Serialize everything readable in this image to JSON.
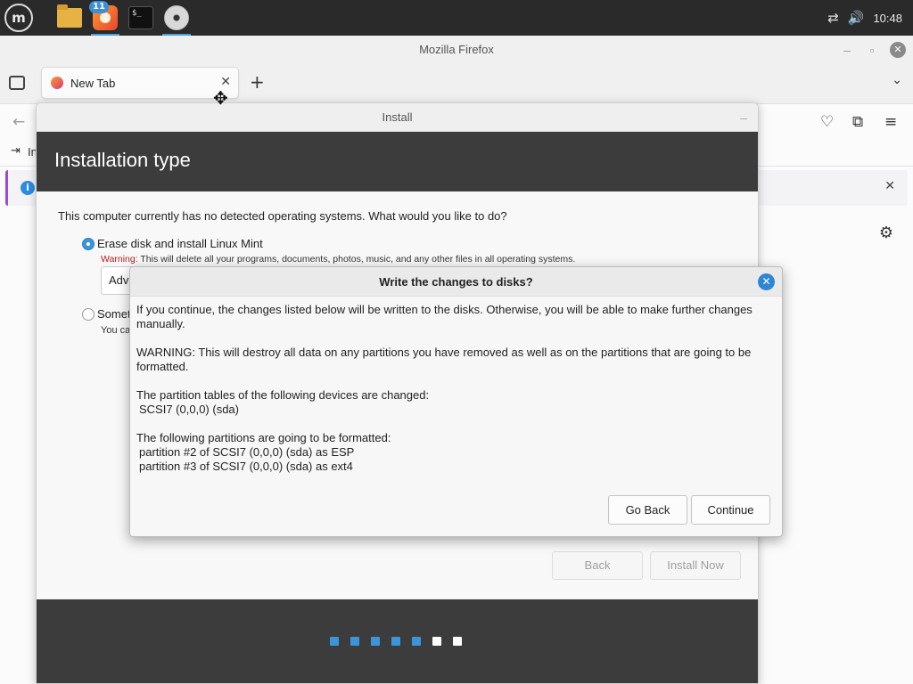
{
  "taskbar": {
    "menu_logo": "m",
    "firefox_badge": "11",
    "terminal_prompt": "$_",
    "clock": "10:48",
    "icons": [
      "mint-menu-icon",
      "files-icon",
      "firefox-icon",
      "terminal-icon",
      "disc-icon",
      "network-icon",
      "volume-icon"
    ]
  },
  "firefox": {
    "window_title": "Mozilla Firefox",
    "tab_label": "New Tab",
    "tab_close": "✕",
    "new_tab": "+",
    "bookmark_partial": "In",
    "info_icon": "i",
    "info_close": "✕"
  },
  "installer": {
    "window_title": "Install",
    "heading": "Installation type",
    "question": "This computer currently has no detected operating systems. What would you like to do?",
    "option_erase": "Erase disk and install Linux Mint",
    "warning_label": "Warning:",
    "warning_text": " This will delete all your programs, documents, photos, music, and any other files in all operating systems.",
    "advanced_button": "Adv",
    "option_something": "Someth",
    "option_something_note": "You ca",
    "back_button": "Back",
    "install_button": "Install Now",
    "progress": {
      "total": 7,
      "completed": 5,
      "active_color": "#3b95d8",
      "pending_color": "#ffffff"
    }
  },
  "dialog": {
    "title": "Write the changes to disks?",
    "close": "✕",
    "para1": "If you continue, the changes listed below will be written to the disks. Otherwise, you will be able to make further changes manually.",
    "para2": "WARNING: This will destroy all data on any partitions you have removed as well as on the partitions that are going to be formatted.",
    "para3_heading": "The partition tables of the following devices are changed:",
    "para3_items": [
      "SCSI7 (0,0,0) (sda)"
    ],
    "para4_heading": "The following partitions are going to be formatted:",
    "para4_items": [
      "partition #2 of SCSI7 (0,0,0) (sda) as ESP",
      "partition #3 of SCSI7 (0,0,0) (sda) as ext4"
    ],
    "go_back_button": "Go Back",
    "continue_button": "Continue"
  }
}
